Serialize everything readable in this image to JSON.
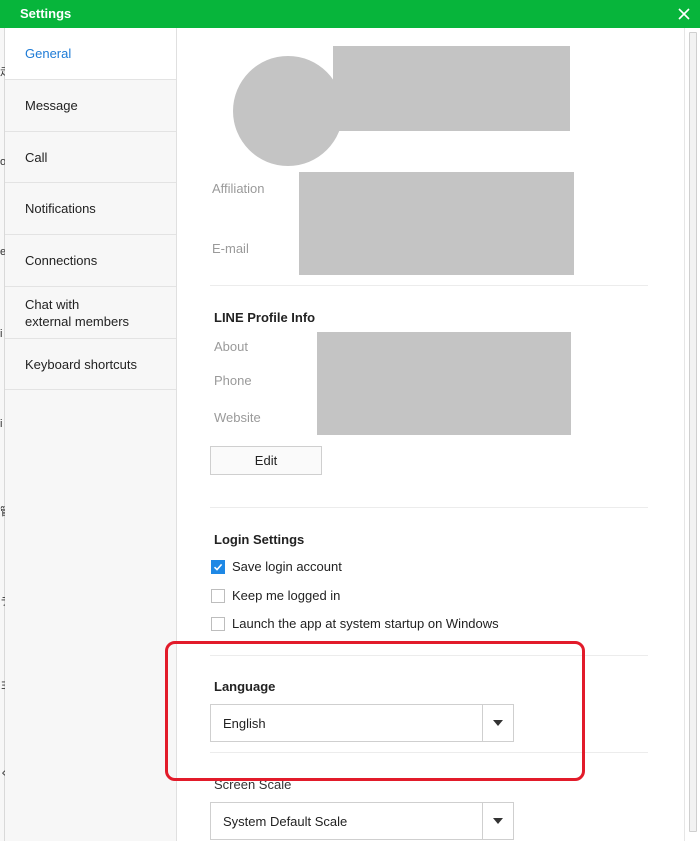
{
  "window": {
    "title": "Settings"
  },
  "sidebar": {
    "items": [
      {
        "label": "General",
        "active": true
      },
      {
        "label": "Message",
        "active": false
      },
      {
        "label": "Call",
        "active": false
      },
      {
        "label": "Notifications",
        "active": false
      },
      {
        "label": "Connections",
        "active": false
      },
      {
        "label_line1": "Chat with",
        "label_line2": "external members",
        "active": false
      },
      {
        "label": "Keyboard shortcuts",
        "active": false
      }
    ]
  },
  "profile": {
    "affiliation_label": "Affiliation",
    "email_label": "E-mail"
  },
  "line_profile": {
    "title": "LINE Profile Info",
    "about_label": "About",
    "phone_label": "Phone",
    "website_label": "Website",
    "edit_label": "Edit"
  },
  "login": {
    "title": "Login Settings",
    "options": [
      {
        "label": "Save login account",
        "checked": true
      },
      {
        "label": "Keep me logged in",
        "checked": false
      },
      {
        "label": "Launch the app at system startup on Windows",
        "checked": false
      }
    ]
  },
  "language": {
    "title": "Language",
    "selected": "English"
  },
  "screen_scale": {
    "title": "Screen Scale",
    "selected": "System Default Scale"
  },
  "colors": {
    "titlebar": "#07b53b",
    "active_nav": "#1e7bd6",
    "checkbox_checked": "#1e88e5",
    "highlight": "#e21b2a",
    "placeholder": "#c4c4c4"
  }
}
